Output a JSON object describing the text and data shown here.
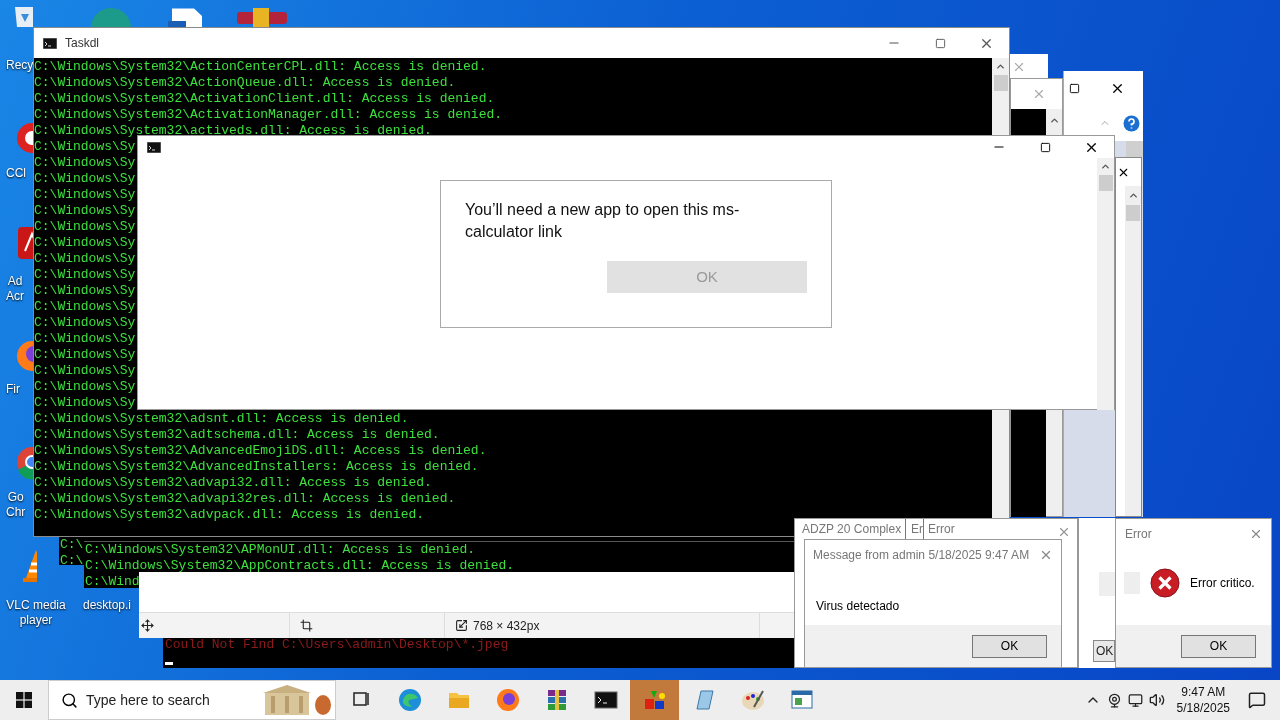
{
  "desktop_icons": [
    {
      "kind": "recycle",
      "label": "Recy"
    },
    {
      "kind": "ccleaner",
      "label": "CCl"
    },
    {
      "kind": "acrobat",
      "label": "Ad\nAcr"
    },
    {
      "kind": "firefox",
      "label": "Fir"
    },
    {
      "kind": "chrome",
      "label": "Go\nChr"
    },
    {
      "kind": "vlc",
      "label": "VLC media\nplayer"
    },
    {
      "kind": "file",
      "label": "desktop.i"
    }
  ],
  "taskdl_window": {
    "title": "Taskdl",
    "lines": [
      "C:\\Windows\\System32\\ActionCenterCPL.dll: Access is denied.",
      "C:\\Windows\\System32\\ActionQueue.dll: Access is denied.",
      "C:\\Windows\\System32\\ActivationClient.dll: Access is denied.",
      "C:\\Windows\\System32\\ActivationManager.dll: Access is denied.",
      "C:\\Windows\\System32\\activeds.dll: Access is denied.",
      "C:\\Windows\\Sy",
      "C:\\Windows\\Sy",
      "C:\\Windows\\Sy",
      "C:\\Windows\\Sy",
      "C:\\Windows\\Sy",
      "C:\\Windows\\Sy",
      "C:\\Windows\\Sy",
      "C:\\Windows\\Sy",
      "C:\\Windows\\Sy",
      "C:\\Windows\\Sy",
      "C:\\Windows\\Sy",
      "C:\\Windows\\Sy",
      "C:\\Windows\\Sy",
      "C:\\Windows\\Sy",
      "C:\\Windows\\Sy",
      "C:\\Windows\\Sy",
      "C:\\Windows\\Sy",
      "C:\\Windows\\System32\\adsnt.dll: Access is denied.",
      "C:\\Windows\\System32\\adtschema.dll: Access is denied.",
      "C:\\Windows\\System32\\AdvancedEmojiDS.dll: Access is denied.",
      "C:\\Windows\\System32\\AdvancedInstallers: Access is denied.",
      "C:\\Windows\\System32\\advapi32.dll: Access is denied.",
      "C:\\Windows\\System32\\advapi32res.dll: Access is denied.",
      "C:\\Windows\\System32\\advpack.dll: Access is denied."
    ]
  },
  "console_back": {
    "lines": [
      "C:\\",
      "C:\\"
    ]
  },
  "console_front": {
    "lines": [
      "C:\\Windows\\System32\\APMonUI.dll: Access is denied.",
      "C:\\Windows\\System32\\AppContracts.dll: Access is denied.",
      "C:\\Wind"
    ]
  },
  "console_bottom": {
    "line": "Could Not Find C:\\Users\\admin\\Desktop\\*.jpeg"
  },
  "image_viewer": {
    "size": "768 × 432px"
  },
  "app_window": {
    "dialog": {
      "message": "You’ll need a new app to open this ms-calculator link",
      "button": {
        "label": "OK",
        "disabled": true
      }
    }
  },
  "complex_window": {
    "title": "ADZP 20 Complex",
    "tab_1": "Er",
    "tab_2": "Error"
  },
  "message_dialog": {
    "title": "Message from admin 5/18/2025 9:47 AM",
    "message": "Virus detectado",
    "button": "OK"
  },
  "middle_dialog": {
    "button": "OK"
  },
  "error_dialog": {
    "title": "Error",
    "message": "Error critico.",
    "button": "OK"
  },
  "taskbar": {
    "search_placeholder": "Type here to search",
    "apps": [
      {
        "kind": "task-view",
        "active": false
      },
      {
        "kind": "edge",
        "active": false
      },
      {
        "kind": "explorer",
        "active": false
      },
      {
        "kind": "firefox",
        "active": false
      },
      {
        "kind": "winrar",
        "active": false
      },
      {
        "kind": "terminal",
        "active": false
      },
      {
        "kind": "shapes",
        "active": true
      },
      {
        "kind": "notepad",
        "active": false
      },
      {
        "kind": "paint",
        "active": false
      },
      {
        "kind": "window",
        "active": false
      }
    ],
    "time": "9:47 AM",
    "date": "5/18/2025"
  }
}
